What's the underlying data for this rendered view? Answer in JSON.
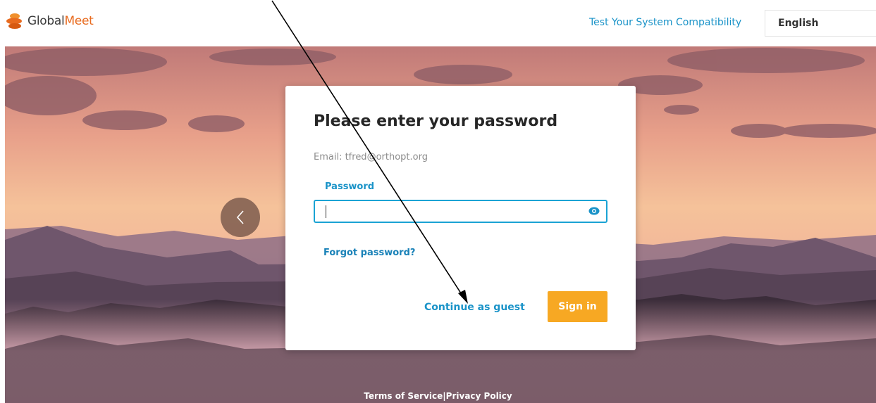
{
  "brand": {
    "name_prefix": "Global",
    "name_suffix": "Meet",
    "logo_icon": "globalmeet-logo-icon"
  },
  "header": {
    "compatibility_link": "Test Your System Compatibility",
    "language": "English"
  },
  "carousel": {
    "prev_icon": "chevron-left-icon"
  },
  "login_card": {
    "title": "Please enter your password",
    "email_line": "Email: tfred@orthopt.org",
    "password_label": "Password",
    "password_value": "",
    "password_toggle_icon": "eye-icon",
    "forgot_link": "Forgot password?",
    "guest_link": "Continue as guest",
    "signin_button": "Sign in"
  },
  "footer": {
    "terms": "Terms of Service",
    "separator": "|",
    "privacy": "Privacy Policy"
  },
  "colors": {
    "accent_blue": "#1a93c8",
    "brand_orange": "#e86b1f",
    "signin_orange": "#f7a823"
  }
}
